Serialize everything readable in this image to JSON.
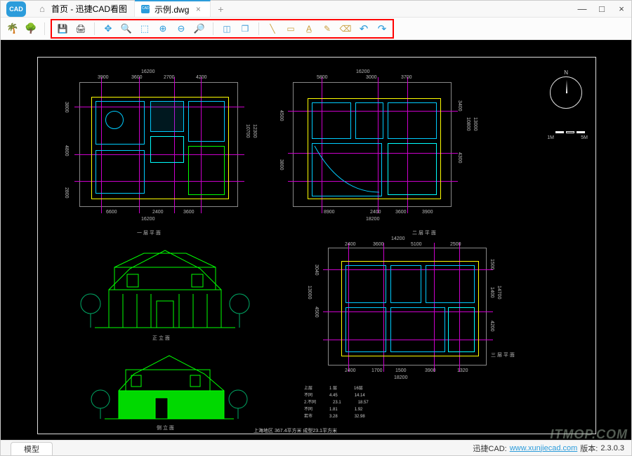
{
  "app": {
    "logo_text": "CAD"
  },
  "tabs": {
    "home": {
      "label": "首页 - 迅捷CAD看图"
    },
    "doc": {
      "label": "示例.dwg",
      "close": "×"
    },
    "add": "+"
  },
  "window_controls": {
    "min": "—",
    "max": "□",
    "close": "×"
  },
  "toolbar": {
    "group_left": {
      "palm": "palm-icon",
      "tree": "tree-icon"
    },
    "highlighted": {
      "save": "save-icon",
      "print": "print-icon",
      "pan": "pan-icon",
      "zoom_ext": "zoom-extents-icon",
      "window_zoom": "zoom-window-icon",
      "zoom_in": "zoom-in-icon",
      "zoom_out": "zoom-out-icon",
      "zoom_realtime": "zoom-realtime-icon",
      "view3d_1": "3d-view-icon",
      "view3d_2": "3d-box-icon",
      "measure_line": "measure-distance-icon",
      "measure_rect": "measure-area-icon",
      "text": "text-icon",
      "annotate": "annotate-icon",
      "erase": "erase-icon",
      "undo": "undo-icon",
      "redo": "redo-icon"
    }
  },
  "drawing": {
    "plans": {
      "first_floor": {
        "label": "一 层 平 面",
        "dims_top": [
          "3900",
          "3600",
          "2700",
          "4200"
        ],
        "dims_top_total": "16200",
        "dims_left": [
          "3800",
          "4800",
          "2800"
        ],
        "dims_right": [
          "10700",
          "12300"
        ],
        "dims_bottom": [
          "6600",
          "2400",
          "3600"
        ],
        "dims_bottom_total": "16200"
      },
      "second_floor": {
        "label": "二 层 平 面",
        "dims_top": [
          "5800",
          "3000",
          "3700"
        ],
        "dims_top_total": "16200",
        "dims_left": [
          "4500",
          "3800"
        ],
        "dims_right": [
          "3400",
          "4300",
          "10800",
          "13000"
        ],
        "dims_bottom": [
          "8900",
          "2400",
          "3600",
          "3900"
        ],
        "dims_bottom_total": "18200"
      },
      "third_floor": {
        "label": "三 层 平 面",
        "dims_top": [
          "2400",
          "3600",
          "5100",
          "2500"
        ],
        "dims_top_total": "14200",
        "dims_left": [
          "3040",
          "4500",
          "13000"
        ],
        "dims_right": [
          "14700",
          "1500",
          "1400",
          "4200"
        ],
        "dims_bottom": [
          "2400",
          "1700",
          "1500",
          "3900",
          "1320"
        ],
        "dims_bottom_total": "18200"
      }
    },
    "elevations": {
      "front": {
        "label": "正 立 面"
      },
      "side": {
        "label": "侧 立 面"
      }
    },
    "compass": {
      "n": "N"
    },
    "scalebar": {
      "left": "1M",
      "right": "5M"
    },
    "bottom_title": "上海地区   367.4平方米   成型23.1平方米",
    "legend": {
      "rows": [
        [
          "上层",
          "1 层",
          "16层"
        ],
        [
          "不同",
          "4.45",
          "14.14"
        ],
        [
          "2.不同",
          "23.1",
          "18.57"
        ],
        [
          "不同",
          "1.81",
          "1.92"
        ],
        [
          "若市",
          "3.28",
          "32.98"
        ]
      ]
    }
  },
  "statusbar": {
    "tab": "模型",
    "product": "迅捷CAD:",
    "url": "www.xunjiecad.com",
    "version_label": "版本:",
    "version": "2.3.0.3"
  },
  "watermark": "ITMOP.COM"
}
